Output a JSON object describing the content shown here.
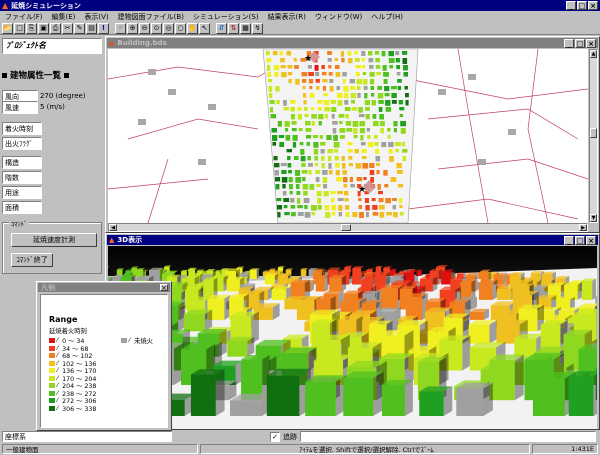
{
  "app": {
    "title": "延焼シミュレーション",
    "title_icon": "flame-icon"
  },
  "menu": [
    "ファイル(F)",
    "編集(E)",
    "表示(V)",
    "建物図面ファイル(B)",
    "シミュレーション(S)",
    "結果表示(R)",
    "ウィンドウ(W)",
    "ヘルプ(H)"
  ],
  "toolbar": {
    "buttons": [
      "open-icon",
      "new-icon",
      "copy-icon",
      "save-icon",
      "print-icon",
      "cut-icon",
      "edit-icon",
      "paste-icon",
      "info-icon",
      "marker-icon",
      "zoom-in-icon",
      "zoom-out-icon",
      "zoom-fit-icon",
      "zoom-area-icon",
      "zoom-prev-icon",
      "pan-icon",
      "arrow-icon",
      "import-icon",
      "export-icon",
      "layers-icon",
      "run-icon"
    ]
  },
  "left": {
    "project_header": "ﾌﾟﾛｼﾞｪｸﾄ名",
    "section_title": "建物属性一覧",
    "props": [
      {
        "label": "風向",
        "value": "270 (degree)"
      },
      {
        "label": "風速",
        "value": "5 (m/s)"
      }
    ],
    "list": [
      "着火時刻",
      "出火ﾌﾗｸﾞ",
      "構造",
      "階数",
      "用途",
      "面積"
    ],
    "command_group": "ｺﾏﾝﾄﾞ",
    "btn_calc": "延焼速度計測",
    "btn_end": "ｺﾏﾝﾄﾞ終了"
  },
  "map_window": {
    "title": "Building.bds"
  },
  "view3d": {
    "title": "3D表示"
  },
  "legend_window": {
    "title": "凡例",
    "heading": "Range",
    "subtitle": "延焼着火時刻",
    "items": [
      {
        "label": "0 ～ 34",
        "color": "#e01010"
      },
      {
        "label": "34 ～ 68",
        "color": "#f04020"
      },
      {
        "label": "68 ～ 102",
        "color": "#f08020"
      },
      {
        "label": "102 ～ 136",
        "color": "#f0c020"
      },
      {
        "label": "136 ～ 170",
        "color": "#f0f020"
      },
      {
        "label": "170 ～ 204",
        "color": "#c8e820"
      },
      {
        "label": "204 ～ 238",
        "color": "#90d820"
      },
      {
        "label": "238 ～ 272",
        "color": "#50c020"
      },
      {
        "label": "272 ～ 306",
        "color": "#20a020"
      },
      {
        "label": "306 ～ 338",
        "color": "#107010"
      }
    ],
    "unburned": {
      "label": "未焼火",
      "color": "#a0a0a0"
    }
  },
  "coord": {
    "label": "座標系",
    "checkbox_label": "追跡",
    "checked": true
  },
  "status": {
    "left": "一般建物面",
    "middle": "ｱｲﾃﾑを選択. Shiftで選択/選択解除. Ctrlでｽﾞｰﾑ",
    "right": "1:431E"
  }
}
